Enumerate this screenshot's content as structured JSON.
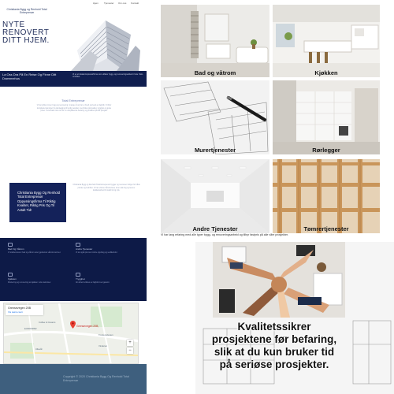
{
  "site": {
    "nav": [
      "Hjem",
      "Tjenester",
      "Om oss",
      "Kontakt"
    ],
    "logo_text": "Christiania Bygg og Renhold Total Entreprenør",
    "hero_title_lines": [
      "NYTE",
      "RENOVERT",
      "DITT HJEM."
    ],
    "strip_left": "La Oss Dra På En Reise Og Finne Ditt Drømmehus",
    "strip_right": "Vi er et totalentreprenørfirma som utfører bygg- og renoveringsarbeid i hele Oslo-området.",
    "section_title": "Total Entreprenør",
    "para1": "Vi har jobbet innen bygg og renovering i mange år og har et bredt nettverk av fagfolk. Vi tilbyr komplette løsninger fra planlegging til ferdig resultat, med fokus på kvalitet, trygghet og gode priser. Ta kontakt med oss for en uforpliktende befaring og pristilbud på ditt prosjekt.",
    "blue_card": "Christiania Bygg Og Renhold Total Entreprenør Oppussingsfirma Til Riktig Kvalitet, Riktig Pris Og Til Avtalt Tid!",
    "para2": "Christiania Bygg og Renhold Total Entreprenør bygger og renoverer boliger for både private og bedrifter. Vi har erfarne håndverkere innen alle fag og leverer kvalitetsarbeid til avtalt tid og pris.",
    "features": [
      {
        "title": "Bad Og Våtrom",
        "text": "Vi totalrenoverer bad og våtrom etter gjeldende våtromsnormer."
      },
      {
        "title": "Andre Tjenester",
        "text": "Vi tar også på oss mindre oppdrag og vedlikehold."
      },
      {
        "title": "Kjøkken",
        "text": "Montering og renovering av kjøkken i alle størrelser."
      },
      {
        "title": "Trygghet",
        "text": "Alt arbeid utføres av fagfolk med garanti."
      }
    ],
    "map": {
      "place_name": "Grensevegen 20B",
      "link": "Vis større kart",
      "pin_label": "Grensevegen 20B,",
      "labels": [
        "Coffee & Creams",
        "EUROSPAR",
        "Trosterudveien",
        "Vinderen",
        "Ullevål"
      ],
      "zoom_in": "+",
      "zoom_out": "−"
    },
    "footer": "Copyright © 2020 Christiania Bygg Og Renhold Total Entreprenør"
  },
  "services": [
    {
      "label": "Bad og våtrom"
    },
    {
      "label": "Kjøkken"
    },
    {
      "label": "Murertjenester"
    },
    {
      "label": "Rørlegger"
    },
    {
      "label": "Andre Tjenester"
    },
    {
      "label": "Tømrertjenester"
    }
  ],
  "strip_text": "Vi har lang erfaring med alle typer bygg- og renoveringsarbeid og tilbyr fastpris på alle våre prosjekter.",
  "quality": {
    "caption_lines": [
      "Kvalitetssikrer",
      "prosjektene før befaring,",
      "slik at du kun bruker tid",
      "på seriøse prosjekter."
    ]
  },
  "colors": {
    "navy": "#101e4f",
    "dark_navy": "#0d1a47",
    "card_blue": "#14225a",
    "footer_blue": "#3e5f7e"
  }
}
